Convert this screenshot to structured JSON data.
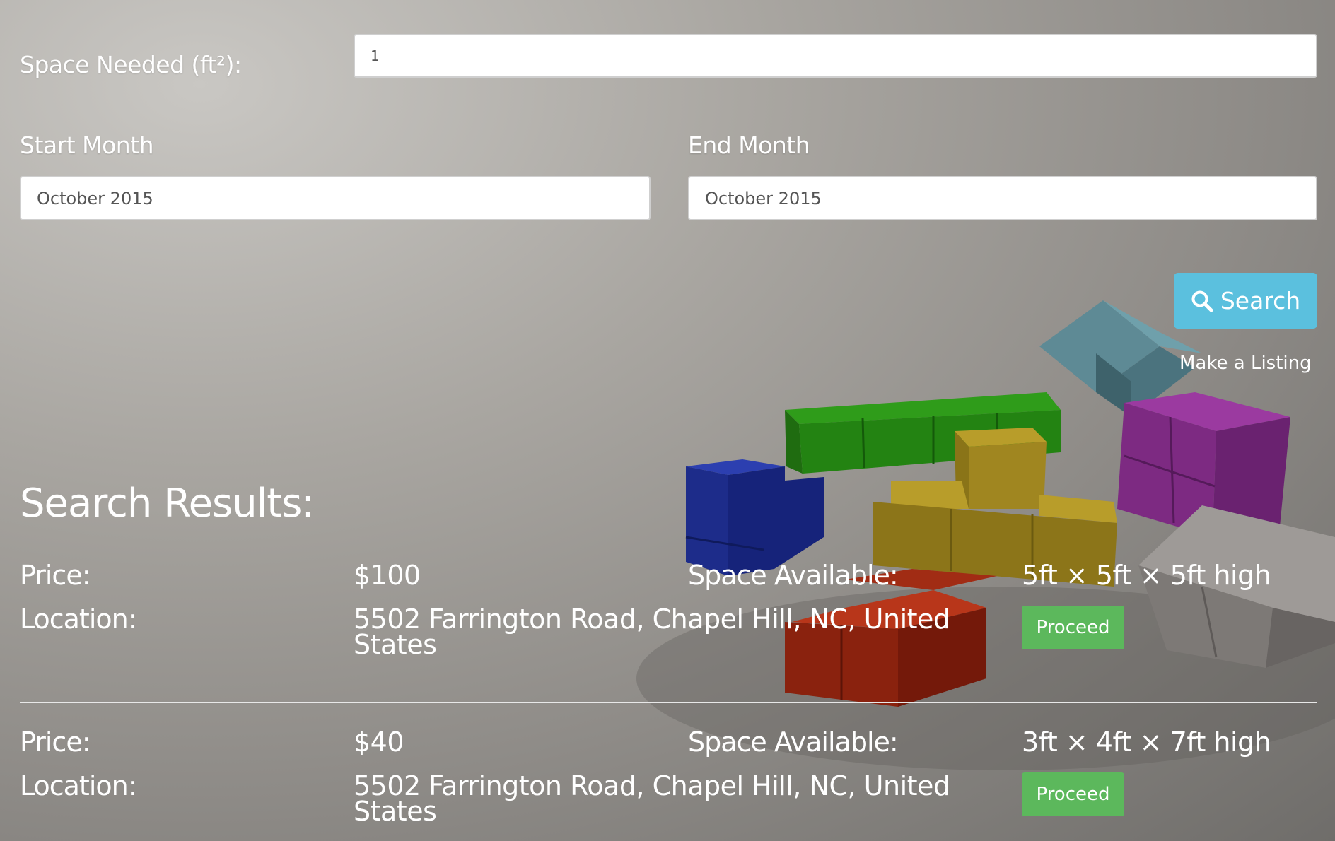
{
  "form": {
    "space_label": "Space Needed (ft²):",
    "space_value": "1",
    "start_label": "Start Month",
    "start_value": "October 2015",
    "end_label": "End Month",
    "end_value": "October 2015",
    "search_label": "Search",
    "make_listing_label": "Make a Listing"
  },
  "results": {
    "title": "Search Results:",
    "price_label": "Price:",
    "location_label": "Location:",
    "space_label": "Space Available:",
    "proceed_label": "Proceed",
    "items": [
      {
        "price": "$100",
        "space": "5ft × 5ft × 5ft high",
        "location_line1": "5502 Farrington Road, Chapel Hill, NC, United",
        "location_line2": "States"
      },
      {
        "price": "$40",
        "space": "3ft × 4ft × 7ft high",
        "location_line1": "5502 Farrington Road, Chapel Hill, NC, United",
        "location_line2": "States"
      }
    ]
  },
  "colors": {
    "search_button": "#5bc0de",
    "proceed_button": "#5cb85c"
  },
  "icons": {
    "search": "search-icon",
    "background": "tetris-blocks-background"
  }
}
